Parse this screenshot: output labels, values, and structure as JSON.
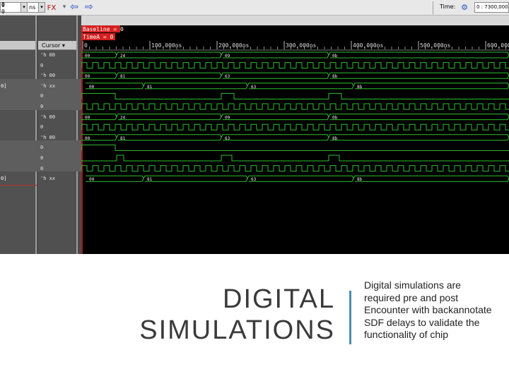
{
  "toolbar": {
    "field_blank": "",
    "unit": "ns",
    "time_label": "Time:",
    "time_value": "0 : 7300,000"
  },
  "left_pane": {
    "top_nums": [
      "0",
      "0"
    ],
    "col_headers": [
      "",
      "Cursor ▾"
    ],
    "rows": [
      {
        "name": "",
        "value": "'h 00"
      },
      {
        "name": "",
        "value": "0"
      },
      {
        "name": "",
        "value": "'h 00"
      },
      {
        "name": "0]",
        "value": "'h xx"
      },
      {
        "name": "",
        "value": "0"
      },
      {
        "name": "",
        "value": "0"
      },
      {
        "name": "",
        "value": "'h 00"
      },
      {
        "name": "",
        "value": "0"
      },
      {
        "name": "",
        "value": "'h 00"
      },
      {
        "name": "",
        "value": "0"
      },
      {
        "name": "",
        "value": "0"
      },
      {
        "name": "",
        "value": "0"
      },
      {
        "name": "0]",
        "value": "'h xx"
      }
    ]
  },
  "waveform": {
    "baseline_label": "Baseline = 0",
    "timea_label": "TimeA = 0",
    "ruler_labels": [
      "0",
      "100,000ns",
      "200,000ns",
      "300,000ns",
      "400,000ns",
      "500,000ns",
      "600,000"
    ],
    "bus_rows": [
      {
        "row": 0,
        "values": [
          "00",
          "24",
          "09",
          "0b"
        ]
      },
      {
        "row": 2,
        "values": [
          "00",
          "81",
          "63",
          "8b"
        ]
      },
      {
        "row": 3,
        "values": [
          "00",
          "81",
          "63",
          "8b"
        ]
      },
      {
        "row": 6,
        "values": [
          "00",
          "24",
          "09",
          "0b"
        ]
      },
      {
        "row": 8,
        "values": [
          "00",
          "81",
          "63",
          "8b"
        ]
      },
      {
        "row": 12,
        "values": [
          "00",
          "81",
          "63",
          "8b"
        ]
      }
    ]
  },
  "slide": {
    "title_line1": "DIGITAL",
    "title_line2": "SIMULATIONS",
    "body": "Digital simulations are required pre and post Encounter with backannotate SDF delays to validate the functionality of chip"
  }
}
